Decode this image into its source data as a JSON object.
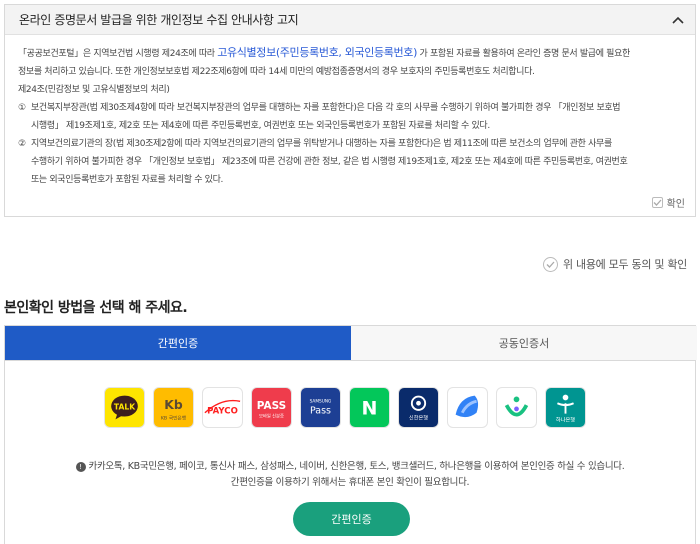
{
  "notice": {
    "title": "온라인 증명문서 발급을 위한 개인정보 수집 안내사항 고지",
    "line1_a": "「공공보건포털」은 지역보건법 시행령 제24조에 따라",
    "line1_highlight": "고유식별정보(주민등록번호, 외국인등록번호)",
    "line1_b": "가 포함된 자료를 활용하여 온라인 증명 문서 발급에 필요한",
    "line2": "정보를 처리하고 있습니다. 또한 개인정보보호법 제22조제6항에 따라 14세 미만의 예방접종증명서의 경우 보호자의 주민등록번호도 처리합니다.",
    "line3": "제24조(민감정보 및 고유식별정보의 처리)",
    "item1_num": "①",
    "item1_l1": "보건복지부장관(법 제30조제4항에 따라 보건복지부장관의 업무를 대행하는 자를 포함한다)은 다음 각 호의 사무를 수행하기 위하여 불가피한 경우 「개인정보 보호법",
    "item1_l2": "시행령」 제19조제1호, 제2호 또는 제4호에 따른 주민등록번호, 여권번호 또는 외국인등록번호가 포함된 자료를 처리할 수 있다.",
    "item2_num": "②",
    "item2_l1": "지역보건의료기관의 장(법 제30조제2항에 따라 지역보건의료기관의 업무를 위탁받거나 대행하는 자를 포함한다)은 법 제11조에 따른 보건소의 업무에 관한 사무를",
    "item2_l2": "수행하기 위하여 불가피한 경우 「개인정보 보호법」 제23조에 따른 건강에 관한 정보, 같은 법 시행령 제19조제1호, 제2호 또는 제4호에 따른 주민등록번호, 여권번호",
    "item2_l3": "또는 외국인등록번호가 포함된 자료를 처리할 수 있다.",
    "confirm_label": "확인"
  },
  "agree_all_label": "위 내용에 모두 동의 및 확인",
  "section_title": "본인확인 방법을 선택 해 주세요.",
  "tabs": [
    {
      "label": "간편인증",
      "active": true
    },
    {
      "label": "공동인증서",
      "active": false
    }
  ],
  "providers": [
    {
      "name": "kakao",
      "label": "TALK",
      "color": "#fee500"
    },
    {
      "name": "kb",
      "label": "KB 국민은행",
      "color": "#ffbc00"
    },
    {
      "name": "payco",
      "label": "PAYCO",
      "color": "#ff1e1e"
    },
    {
      "name": "pass",
      "label": "PASS",
      "sublabel": "모바일 신분증",
      "color": "#ef3c4c"
    },
    {
      "name": "samsung-pass",
      "label": "Pass",
      "sublabel": "SAMSUNG",
      "color": "#1d3f94"
    },
    {
      "name": "naver",
      "label": "N",
      "color": "#03c75a"
    },
    {
      "name": "shinhan",
      "label": "신한은행",
      "color": "#0a2b6b"
    },
    {
      "name": "toss",
      "label": "toss",
      "color": "#3182f6"
    },
    {
      "name": "banksalad",
      "label": "banksalad",
      "color": "#19c181"
    },
    {
      "name": "hana",
      "label": "하나은행",
      "color": "#009591"
    }
  ],
  "info_line1": "카카오톡, KB국민은행, 페이코, 통신사 패스, 삼성패스, 네이버, 신한은행, 토스, 뱅크샐러드, 하나은행을 이용하여 본인인증 하실 수 있습니다.",
  "info_line2": "간편인증을 이용하기 위해서는 휴대폰 본인 확인이 필요합니다.",
  "auth_button_label": "간편인증"
}
